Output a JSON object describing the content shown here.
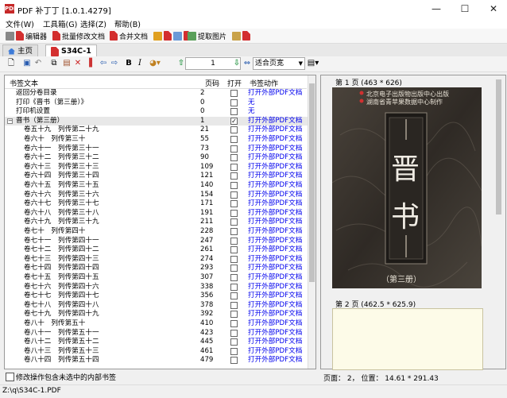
{
  "window": {
    "title": "PDF 补丁丁 [1.0.1.4279]",
    "logo_text": "PDF"
  },
  "menu": [
    "文件(W)",
    "工具箱(G)",
    "选择(Z)",
    "帮助(B)"
  ],
  "toolbar1": [
    "编辑器",
    "批量修改文档",
    "合并文档",
    "提取图片"
  ],
  "tabs": [
    {
      "label": "主页"
    },
    {
      "label": "S34C-1"
    }
  ],
  "toolbar2": {
    "page_value": "1",
    "fit_option": "适合页宽"
  },
  "bookmarks": {
    "columns": [
      "书签文本",
      "页码",
      "打开",
      "书签动作"
    ],
    "rows": [
      {
        "text": "返回分卷目录",
        "page": "2",
        "open": false,
        "action": "打开外部PDF文档",
        "level": 1
      },
      {
        "text": "打印《晋书（第三册）》",
        "page": "0",
        "open": false,
        "action": "无",
        "level": 1
      },
      {
        "text": "打印机设置",
        "page": "0",
        "open": false,
        "action": "无",
        "level": 1
      },
      {
        "text": "晋书（第三册）",
        "page": "1",
        "open": true,
        "action": "打开外部PDF文档",
        "level": 0
      },
      {
        "text": "卷五十九　列传第二十九",
        "page": "21",
        "open": false,
        "action": "打开外部PDF文档",
        "level": 2
      },
      {
        "text": "卷六十　列传第三十",
        "page": "55",
        "open": false,
        "action": "打开外部PDF文档",
        "level": 2
      },
      {
        "text": "卷六十一　列传第三十一",
        "page": "73",
        "open": false,
        "action": "打开外部PDF文档",
        "level": 2
      },
      {
        "text": "卷六十二　列传第三十二",
        "page": "90",
        "open": false,
        "action": "打开外部PDF文档",
        "level": 2
      },
      {
        "text": "卷六十三　列传第三十三",
        "page": "109",
        "open": false,
        "action": "打开外部PDF文档",
        "level": 2
      },
      {
        "text": "卷六十四　列传第三十四",
        "page": "121",
        "open": false,
        "action": "打开外部PDF文档",
        "level": 2
      },
      {
        "text": "卷六十五　列传第三十五",
        "page": "140",
        "open": false,
        "action": "打开外部PDF文档",
        "level": 2
      },
      {
        "text": "卷六十六　列传第三十六",
        "page": "154",
        "open": false,
        "action": "打开外部PDF文档",
        "level": 2
      },
      {
        "text": "卷六十七　列传第三十七",
        "page": "171",
        "open": false,
        "action": "打开外部PDF文档",
        "level": 2
      },
      {
        "text": "卷六十八　列传第三十八",
        "page": "191",
        "open": false,
        "action": "打开外部PDF文档",
        "level": 2
      },
      {
        "text": "卷六十九　列传第三十九",
        "page": "211",
        "open": false,
        "action": "打开外部PDF文档",
        "level": 2
      },
      {
        "text": "卷七十　列传第四十",
        "page": "228",
        "open": false,
        "action": "打开外部PDF文档",
        "level": 2
      },
      {
        "text": "卷七十一　列传第四十一",
        "page": "247",
        "open": false,
        "action": "打开外部PDF文档",
        "level": 2
      },
      {
        "text": "卷七十二　列传第四十二",
        "page": "261",
        "open": false,
        "action": "打开外部PDF文档",
        "level": 2
      },
      {
        "text": "卷七十三　列传第四十三",
        "page": "274",
        "open": false,
        "action": "打开外部PDF文档",
        "level": 2
      },
      {
        "text": "卷七十四　列传第四十四",
        "page": "293",
        "open": false,
        "action": "打开外部PDF文档",
        "level": 2
      },
      {
        "text": "卷七十五　列传第四十五",
        "page": "307",
        "open": false,
        "action": "打开外部PDF文档",
        "level": 2
      },
      {
        "text": "卷七十六　列传第四十六",
        "page": "338",
        "open": false,
        "action": "打开外部PDF文档",
        "level": 2
      },
      {
        "text": "卷七十七　列传第四十七",
        "page": "356",
        "open": false,
        "action": "打开外部PDF文档",
        "level": 2
      },
      {
        "text": "卷七十八　列传第四十八",
        "page": "378",
        "open": false,
        "action": "打开外部PDF文档",
        "level": 2
      },
      {
        "text": "卷七十九　列传第四十九",
        "page": "392",
        "open": false,
        "action": "打开外部PDF文档",
        "level": 2
      },
      {
        "text": "卷八十　列传第五十",
        "page": "410",
        "open": false,
        "action": "打开外部PDF文档",
        "level": 2
      },
      {
        "text": "卷八十一　列传第五十一",
        "page": "423",
        "open": false,
        "action": "打开外部PDF文档",
        "level": 2
      },
      {
        "text": "卷八十二　列传第五十二",
        "page": "445",
        "open": false,
        "action": "打开外部PDF文档",
        "level": 2
      },
      {
        "text": "卷八十三　列传第五十三",
        "page": "461",
        "open": false,
        "action": "打开外部PDF文档",
        "level": 2
      },
      {
        "text": "卷八十四　列传第五十四",
        "page": "479",
        "open": false,
        "action": "打开外部PDF文档",
        "level": 2
      }
    ],
    "bottom_option": "修改操作包含未选中的内部书签"
  },
  "preview": {
    "page1_label": "第 1 页 (463 * 626)",
    "page2_label": "第 2 页 (462.5 * 625.9)",
    "cover": {
      "publisher1": "北京电子出版物出版中心出版",
      "publisher2": "湖南省青苹果数据中心制作",
      "title_char1": "晋",
      "title_char2": "书",
      "volume": "（第三册）"
    },
    "status": "页面： 2， 位置： 14.61 * 291.43"
  },
  "statusbar": {
    "path": "Z:\\q\\S34C-1.PDF"
  }
}
